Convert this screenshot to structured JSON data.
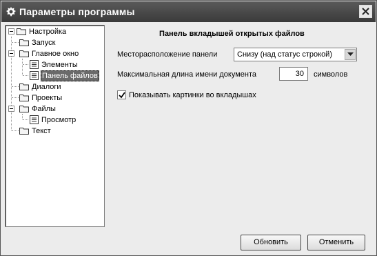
{
  "window": {
    "title": "Параметры программы",
    "icon": "gear-app-icon"
  },
  "tree": {
    "items": [
      {
        "label": "Настройка",
        "icon": "folder-icon"
      },
      {
        "label": "Запуск",
        "icon": "folder-icon"
      },
      {
        "label": "Главное окно",
        "icon": "folder-icon"
      },
      {
        "label": "Элементы",
        "icon": "page-icon"
      },
      {
        "label": "Панель файлов",
        "icon": "page-icon",
        "selected": true
      },
      {
        "label": "Диалоги",
        "icon": "folder-icon"
      },
      {
        "label": "Проекты",
        "icon": "folder-icon"
      },
      {
        "label": "Файлы",
        "icon": "folder-icon"
      },
      {
        "label": "Просмотр",
        "icon": "page-icon"
      },
      {
        "label": "Текст",
        "icon": "folder-icon"
      }
    ]
  },
  "panel": {
    "title": "Панель вкладышей открытых файлов",
    "location_label": "Месторасположение панели",
    "location_value": "Снизу (над статус строкой)",
    "maxlen_label": "Максимальная длина имени документа",
    "maxlen_value": "30",
    "maxlen_unit": "символов",
    "show_images_label": "Показывать картинки во вкладышах",
    "show_images_checked": true
  },
  "buttons": {
    "ok": "Обновить",
    "cancel": "Отменить"
  }
}
